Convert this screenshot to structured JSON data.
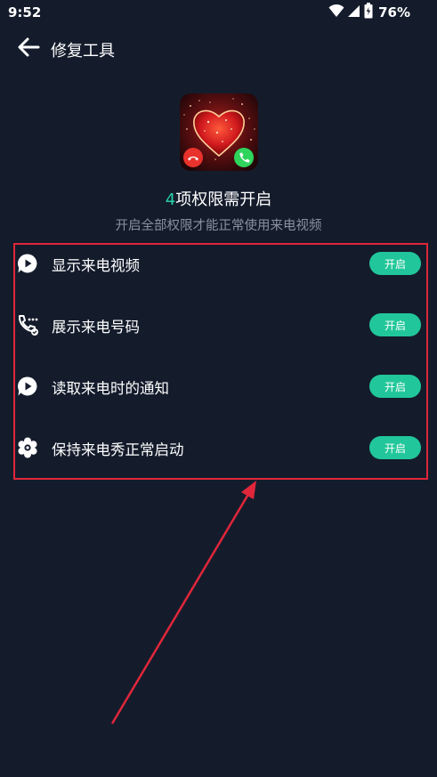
{
  "status_bar": {
    "time": "9:52",
    "battery": "76%",
    "icons": [
      "wifi-icon",
      "signal-icon",
      "battery-icon"
    ]
  },
  "header": {
    "back_icon": "arrow-left-icon",
    "title": "修复工具"
  },
  "summary": {
    "count": "4",
    "headline_text": "项权限需开启",
    "subtitle": "开启全部权限才能正常使用来电视频"
  },
  "permissions": [
    {
      "icon": "video-play-icon",
      "label": "显示来电视频",
      "button": "开启"
    },
    {
      "icon": "phone-dots-icon",
      "label": "展示来电号码",
      "button": "开启"
    },
    {
      "icon": "video-play-icon",
      "label": "读取来电时的通知",
      "button": "开启"
    },
    {
      "icon": "gear-flower-icon",
      "label": "保持来电秀正常启动",
      "button": "开启"
    }
  ],
  "colors": {
    "background": "#141c2c",
    "accent": "#21c79a",
    "count_color": "#27d2a6",
    "highlight_border": "#e0263a",
    "subtitle": "#8a90a0"
  }
}
